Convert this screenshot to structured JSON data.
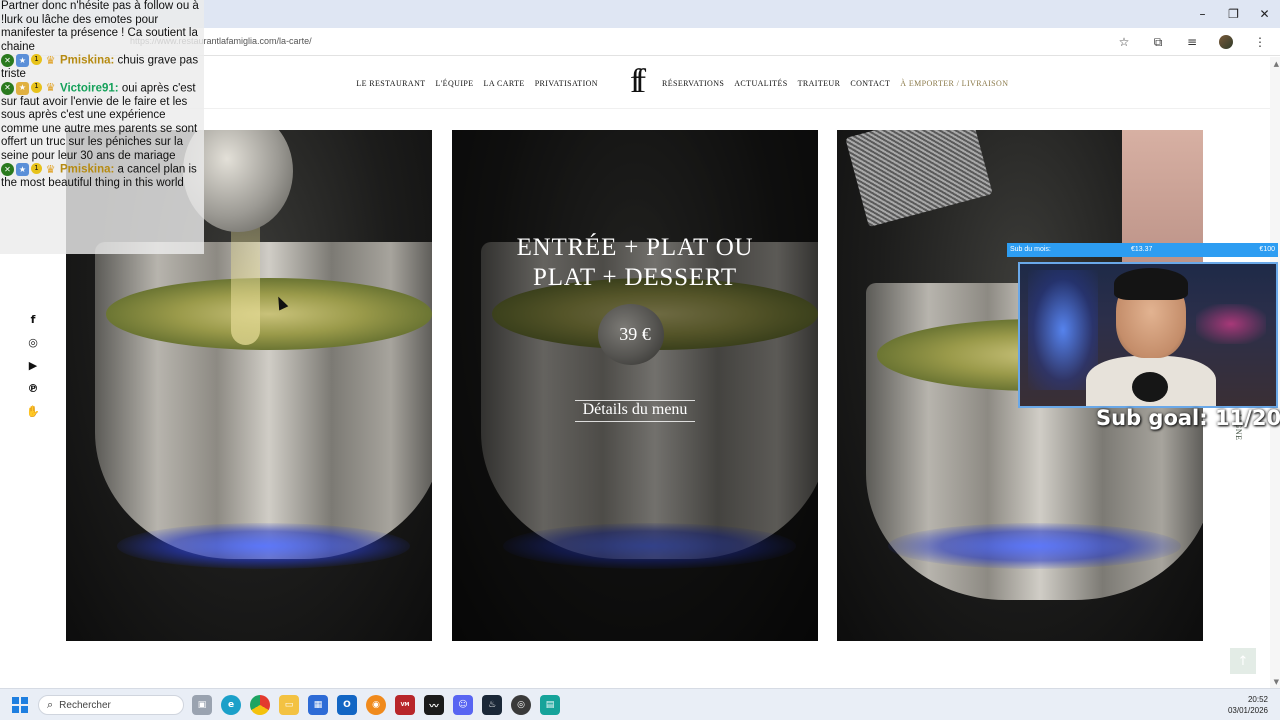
{
  "browser": {
    "url": "https://www.restaurantlafamiglia.com/la-carte/",
    "icons": [
      "bookmark-star-icon",
      "extensions-icon",
      "media-icon",
      "profile-avatar",
      "more-menu-icon"
    ]
  },
  "nav": {
    "left_links": [
      "LE RESTAURANT",
      "L'ÉQUIPE",
      "LA CARTE",
      "PRIVATISATION"
    ],
    "right_links": [
      "RÉSERVATIONS",
      "ACTUALITÉS",
      "TRAITEUR",
      "CONTACT"
    ],
    "accent_link": "À EMPORTER / LIVRAISON",
    "accent_color": "#8b7a4a"
  },
  "social_icons": [
    "facebook-icon",
    "instagram-icon",
    "youtube-icon",
    "pinterest-icon",
    "hand-icon"
  ],
  "menu_card": {
    "title_line1": "ENTRÉE + PLAT OU",
    "title_line2": "PLAT + DESSERT",
    "price": "39 €",
    "link": "Détails du menu"
  },
  "side_tab": "LIGNE",
  "stream_chat": {
    "messages": [
      {
        "user": "",
        "text": "Partner donc n'hésite pas à follow ou à !lurk ou lâche des emotes pour manifester ta présence ! Ca soutient la chaine"
      },
      {
        "user": "Pmiskina:",
        "text": "chuis grave pas triste"
      },
      {
        "user": "Victoire91:",
        "text": "oui après c'est sur faut avoir l'envie de le faire et les sous après c'est une expérience comme une autre mes parents se sont offert un truc sur les péniches sur la seine pour leur 30 ans de mariage"
      },
      {
        "user": "Pmiskina:",
        "text": "a cancel plan is the most beautiful thing in this world"
      }
    ],
    "badge_number": "1"
  },
  "stream_overlay": {
    "sub_bar_label": "Sub du mois:",
    "sub_bar_amount": "€13.37",
    "sub_bar_goal": "€100",
    "sub_goal_text": "Sub goal: 11/20",
    "bar_color": "#2d9df2"
  },
  "taskbar": {
    "search_placeholder": "Rechercher",
    "time": "20:52",
    "date": "03/01/2026",
    "apps": [
      "task-view-icon",
      "edge-icon",
      "chrome-icon",
      "file-explorer-icon",
      "store-icon",
      "outlook-icon",
      "app-icon",
      "voicemeeter-icon",
      "audio-icon",
      "discord-icon",
      "steam-icon",
      "obs-icon",
      "app2-icon"
    ]
  }
}
